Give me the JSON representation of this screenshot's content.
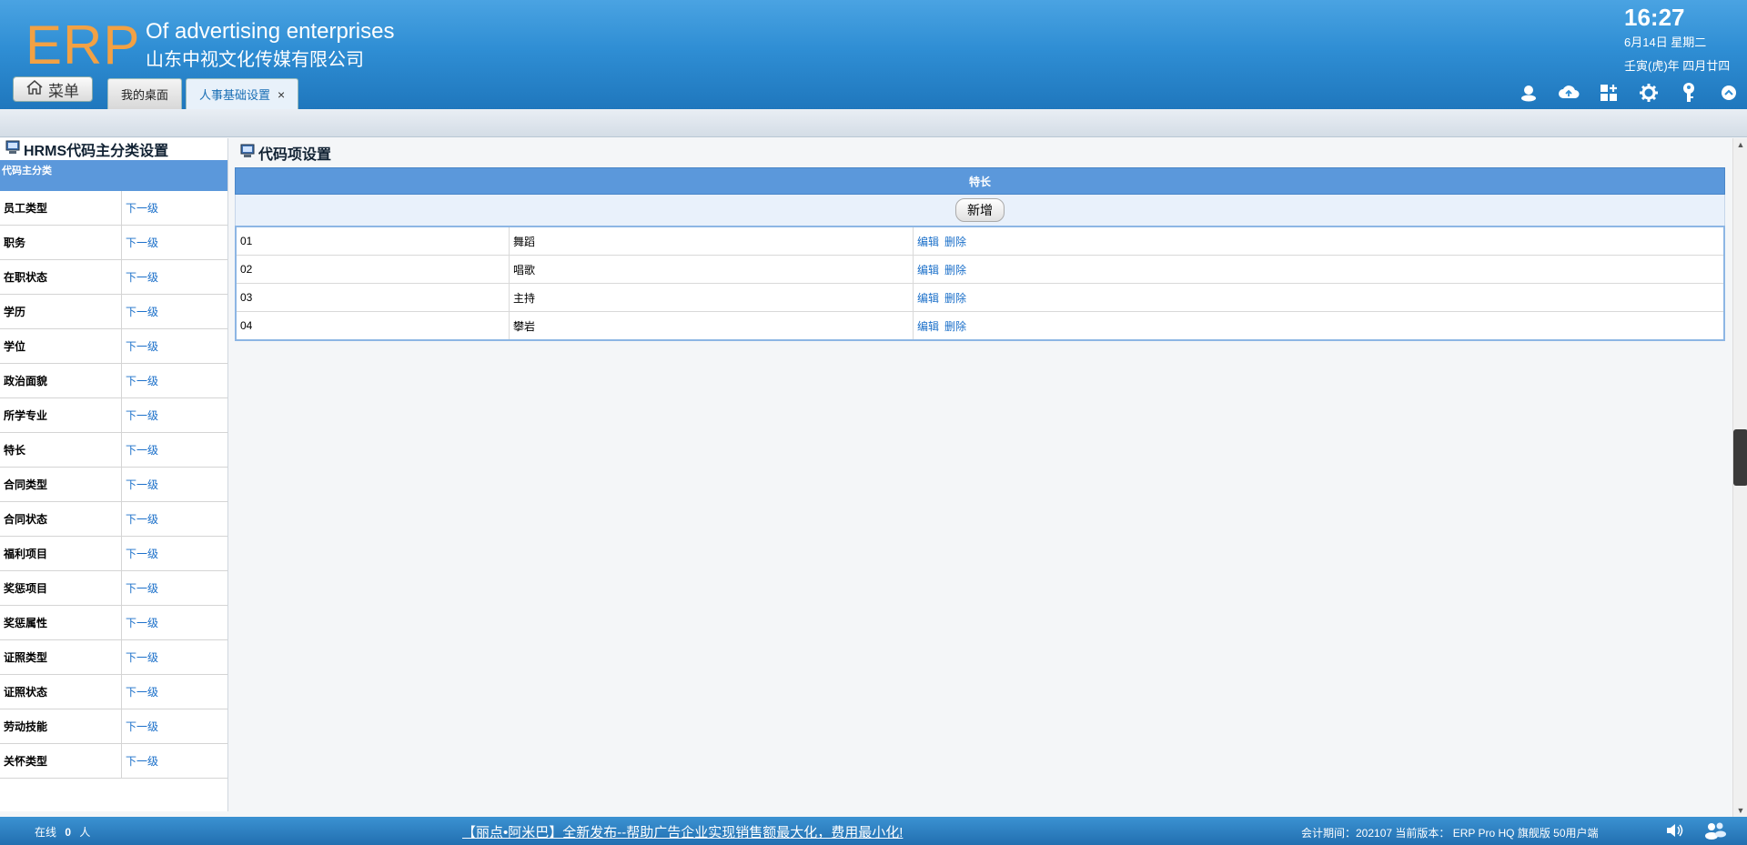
{
  "header": {
    "logo": "ERP",
    "tagline": "Of advertising enterprises",
    "company": "山东中视文化传媒有限公司",
    "menu_label": "菜单",
    "tabs": [
      {
        "label": "我的桌面",
        "active": false
      },
      {
        "label": "人事基础设置",
        "active": true,
        "close": "×"
      }
    ],
    "clock": {
      "time": "16:27",
      "date": "6月14日 星期二",
      "lunar": "壬寅(虎)年 四月廿四"
    },
    "toolbar_icons": [
      "user-icon",
      "cloud-icon",
      "grid-add-icon",
      "gear-icon",
      "key-icon",
      "collapse-icon"
    ]
  },
  "left_panel": {
    "title": "HRMS代码主分类设置",
    "column_header": "代码主分类",
    "link_label": "下一级",
    "categories": [
      "员工类型",
      "职务",
      "在职状态",
      "学历",
      "学位",
      "政治面貌",
      "所学专业",
      "特长",
      "合同类型",
      "合同状态",
      "福利项目",
      "奖惩项目",
      "奖惩属性",
      "证照类型",
      "证照状态",
      "劳动技能",
      "关怀类型"
    ]
  },
  "right_panel": {
    "title": "代码项设置",
    "table_header": "特长",
    "add_label": "新增",
    "edit_label": "编辑",
    "delete_label": "删除",
    "rows": [
      {
        "code": "01",
        "name": "舞蹈"
      },
      {
        "code": "02",
        "name": "唱歌"
      },
      {
        "code": "03",
        "name": "主持"
      },
      {
        "code": "04",
        "name": "攀岩"
      }
    ]
  },
  "status_bar": {
    "online_label": "在线",
    "online_count": "0",
    "online_unit": "人",
    "marquee": "【丽点•阿米巴】全新发布--帮助广告企业实现销售额最大化，费用最小化!",
    "period": "会计期间：202107 当前版本：  ERP Pro HQ 旗舰版 50用户端"
  },
  "colors": {
    "header_top": "#4aa3e2",
    "header_bottom": "#1f77bd",
    "logo": "#f2a144",
    "table_header": "#5b98db",
    "link": "#1a6fc9"
  }
}
